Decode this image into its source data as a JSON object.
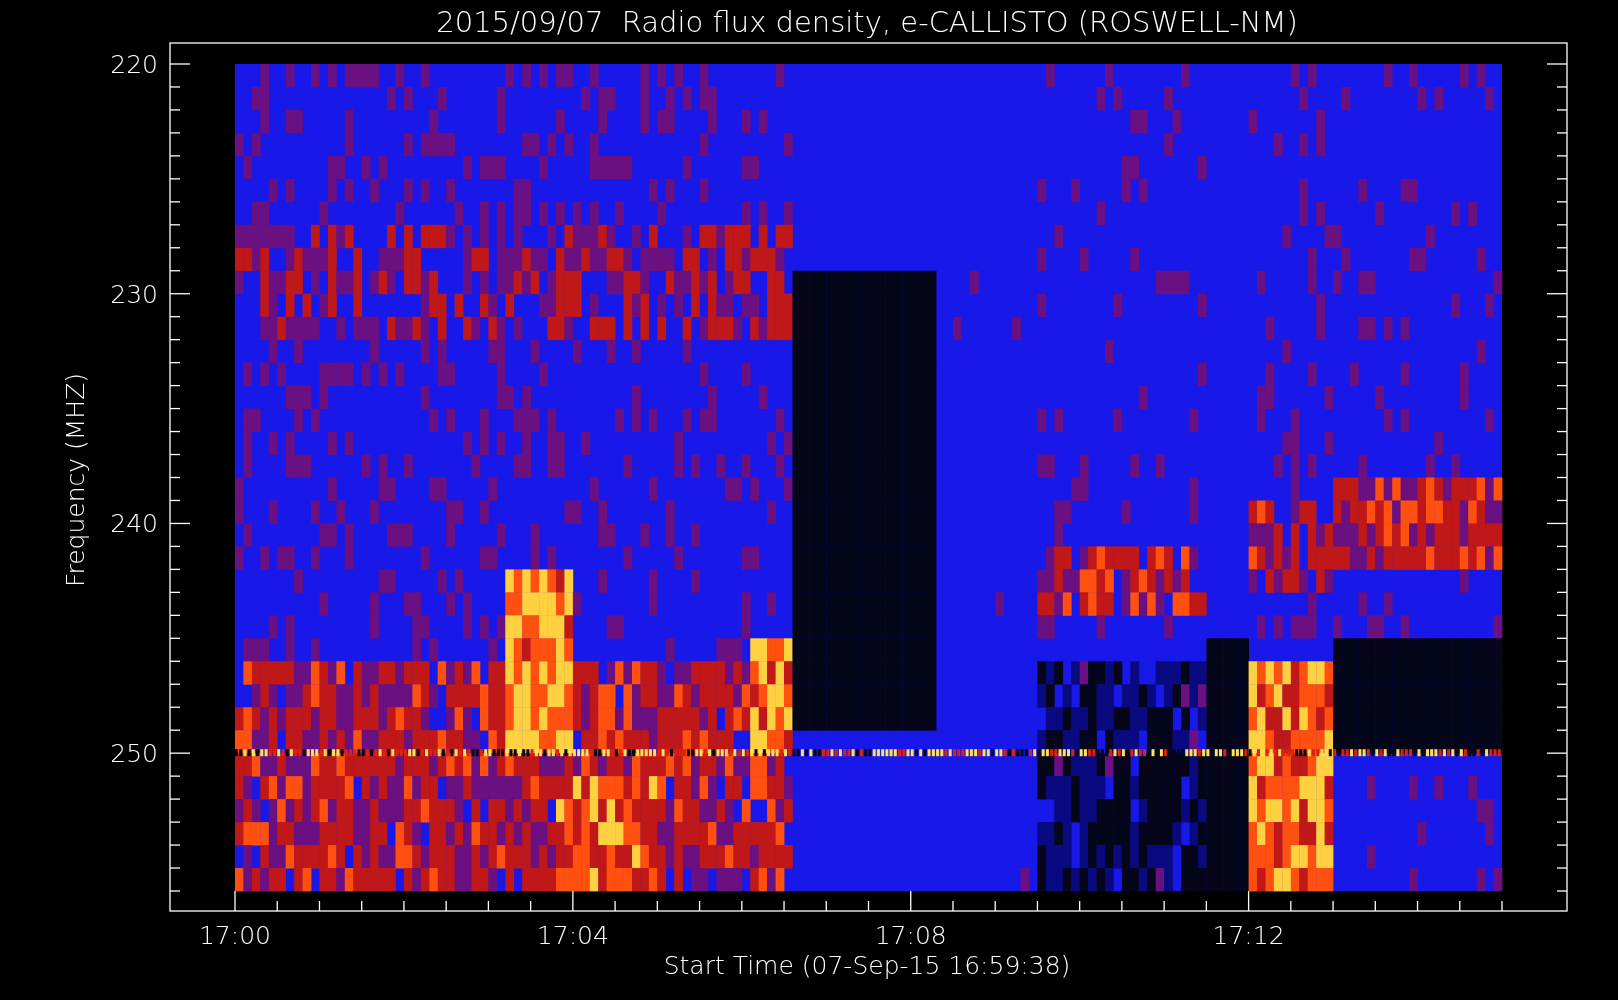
{
  "title": "2015/09/07  Radio flux density, e-CALLISTO (ROSWELL-NM)",
  "y_axis": {
    "label": "Frequency (MHZ)",
    "ticks": [
      "220",
      "230",
      "240",
      "250"
    ]
  },
  "x_axis": {
    "label": "Start Time (07-Sep-15 16:59:38)",
    "ticks": [
      "17:00",
      "17:04",
      "17:08",
      "17:12"
    ]
  }
}
